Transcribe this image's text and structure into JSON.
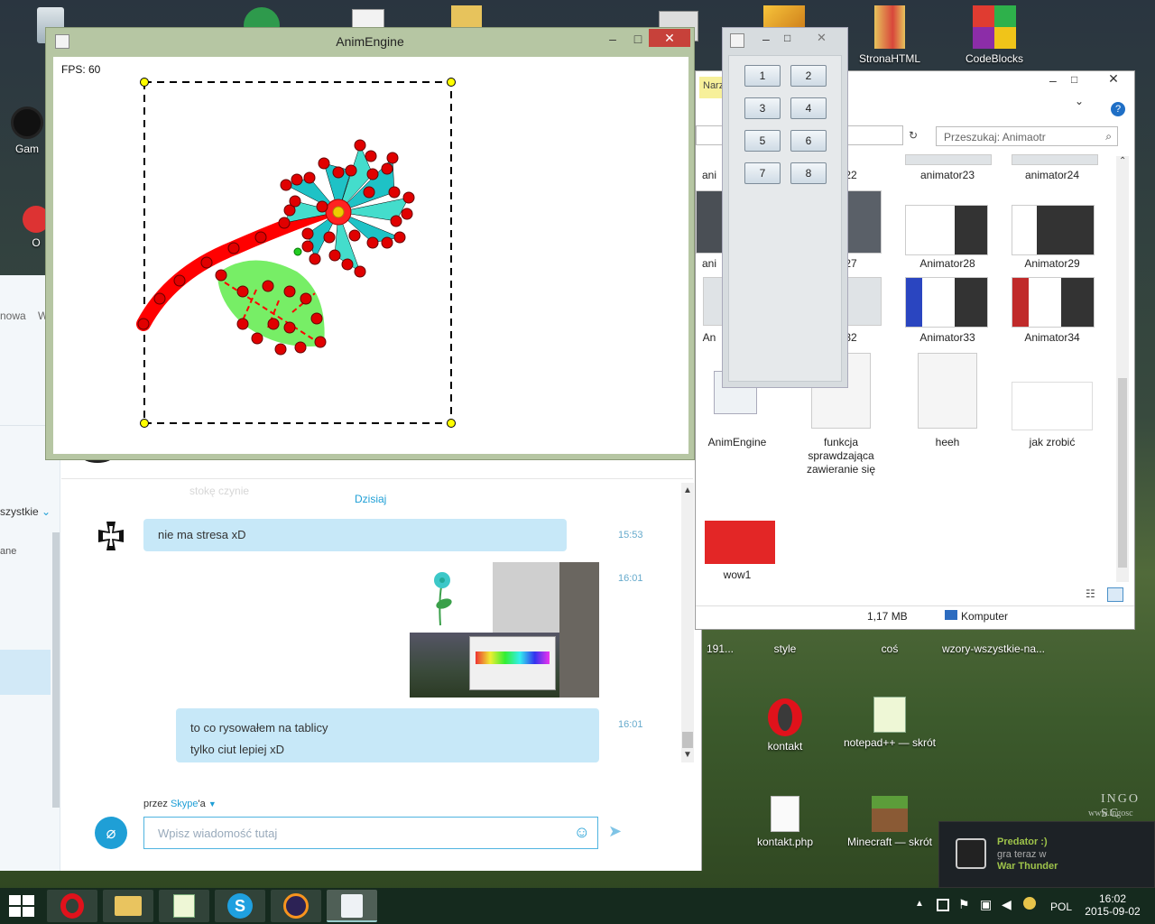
{
  "desktop": {
    "icons_top": [
      {
        "label": "StronaHTML",
        "icon": "folder-icon"
      },
      {
        "label": "CodeBlocks",
        "icon": "codeblocks-icon"
      }
    ],
    "icons_left": [
      {
        "label": "Gam",
        "icon": "game-icon"
      },
      {
        "label": "O",
        "icon": "app-icon"
      }
    ],
    "icons_mid": [
      {
        "label": "191...",
        "icon": "file-icon"
      },
      {
        "label": "style",
        "icon": "file-icon"
      },
      {
        "label": "coś",
        "icon": "file-icon"
      },
      {
        "label": "wzory-wszystkie-na...",
        "icon": "file-icon"
      }
    ],
    "icons_bottom": [
      {
        "label": "kontakt",
        "icon": "opera-icon"
      },
      {
        "label": "notepad++ — skrót",
        "icon": "notepadpp-icon"
      },
      {
        "label": "kontakt.php",
        "icon": "file-icon"
      },
      {
        "label": "Minecraft — skrót",
        "icon": "minecraft-icon"
      }
    ],
    "watermark": "INGO SC",
    "watermark_url": "www.ingosc"
  },
  "anim_engine": {
    "title": "AnimEngine",
    "fps": "FPS: 60",
    "minimize": "–",
    "maximize": "□",
    "close": "✕"
  },
  "button_window": {
    "buttons": [
      "1",
      "2",
      "3",
      "4",
      "5",
      "6",
      "7",
      "8"
    ]
  },
  "explorer": {
    "ribbon_tab": "Narz",
    "search_placeholder": "Przeszukaj: Animaotr",
    "files": [
      {
        "label": "ani"
      },
      {
        "label": "tor22"
      },
      {
        "label": "animator23"
      },
      {
        "label": "animator24"
      },
      {
        "label": "ani"
      },
      {
        "label": "tor27"
      },
      {
        "label": "Animator28"
      },
      {
        "label": "Animator29"
      },
      {
        "label": "An"
      },
      {
        "label": "tor32"
      },
      {
        "label": "Animator33"
      },
      {
        "label": "Animator34"
      },
      {
        "label": "AnimEngine"
      },
      {
        "label": "funkcja sprawdzająca zawieranie się"
      },
      {
        "label": "heeh"
      },
      {
        "label": "jak zrobić"
      },
      {
        "label": "wow1"
      }
    ],
    "status_size": "1,17 MB",
    "status_location": "Komputer"
  },
  "skype": {
    "left_fragments": [
      "nowa",
      "W",
      "szystkie",
      "ane"
    ],
    "faded_text": "stokę czynie",
    "date_divider": "Dzisiaj",
    "messages": [
      {
        "text": "nie ma stresa xD",
        "time": "15:53"
      },
      {
        "text": "",
        "time": "16:01"
      },
      {
        "lines": [
          "to co rysowałem na tablicy",
          "tylko ciut lepiej xD"
        ],
        "time": "16:01"
      }
    ],
    "via_prefix": "przez",
    "via_link": "Skype",
    "via_suffix": "'a",
    "input_placeholder": "Wpisz wiadomość tutaj"
  },
  "notification": {
    "name": "Predator :)",
    "line1": "gra teraz w",
    "game": "War Thunder"
  },
  "taskbar": {
    "language": "POL",
    "time": "16:02",
    "date": "2015-09-02"
  }
}
